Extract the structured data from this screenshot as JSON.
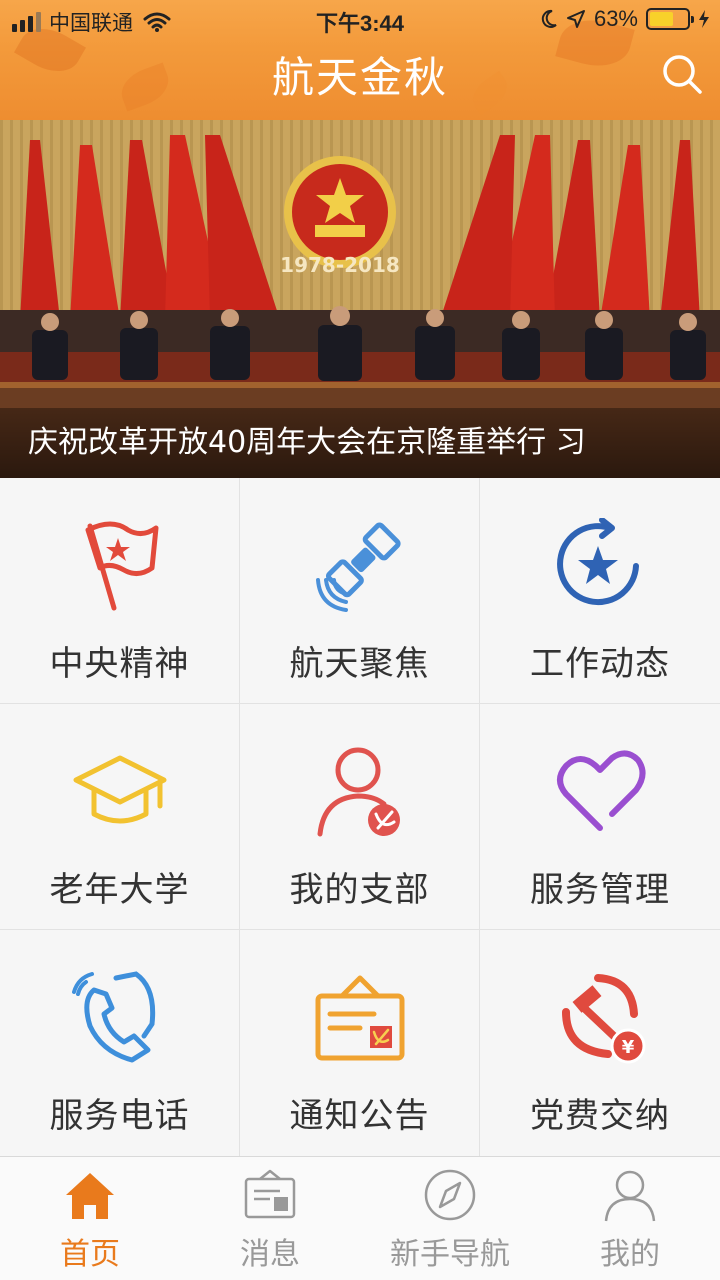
{
  "status_bar": {
    "carrier": "中国联通",
    "time": "下午3:44",
    "battery_percent": "63%",
    "battery_level": 0.63
  },
  "header": {
    "title": "航天金秋",
    "search_icon": "search-icon"
  },
  "banner": {
    "caption": "庆祝改革开放40周年大会在京隆重举行 习",
    "emblem_years": "1978-2018"
  },
  "grid": {
    "items": [
      {
        "label": "中央精神",
        "icon": "red-flag-icon",
        "color": "#e24a3b"
      },
      {
        "label": "航天聚焦",
        "icon": "satellite-icon",
        "color": "#4a90d9"
      },
      {
        "label": "工作动态",
        "icon": "star-refresh-icon",
        "color": "#2f63b4"
      },
      {
        "label": "老年大学",
        "icon": "graduation-cap-icon",
        "color": "#f2c230"
      },
      {
        "label": "我的支部",
        "icon": "member-party-icon",
        "color": "#e0534e"
      },
      {
        "label": "服务管理",
        "icon": "heart-icon",
        "color": "#9a4fd0"
      },
      {
        "label": "服务电话",
        "icon": "phone-icon",
        "color": "#3e8fdb"
      },
      {
        "label": "通知公告",
        "icon": "notice-board-icon",
        "color": "#f0a330"
      },
      {
        "label": "党费交纳",
        "icon": "party-fee-icon",
        "color": "#e04a3e"
      }
    ]
  },
  "tabbar": {
    "tabs": [
      {
        "label": "首页",
        "icon": "home-icon",
        "active": true
      },
      {
        "label": "消息",
        "icon": "message-icon",
        "active": false
      },
      {
        "label": "新手导航",
        "icon": "compass-icon",
        "active": false
      },
      {
        "label": "我的",
        "icon": "user-icon",
        "active": false
      }
    ],
    "active_color": "#e97a1c",
    "inactive_color": "#999999"
  }
}
